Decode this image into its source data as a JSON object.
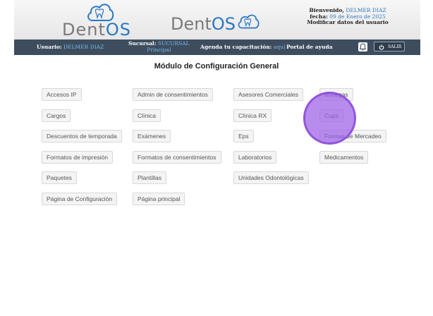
{
  "header": {
    "logo_text": {
      "dent": "Dent",
      "os": "OS"
    },
    "welcome": {
      "greeting": "Bienvenido,",
      "user": "DELMER DIAZ",
      "date_label": "fecha:",
      "date": "09 de Enero de 2025",
      "modify_link": "Modificar datos del usuario"
    }
  },
  "navbar": {
    "usuario_label": "Usuario:",
    "usuario_value": "DELMER DIAZ",
    "sucursal_label": "Sucursal:",
    "sucursal_value_1": "SUCURSAL",
    "sucursal_value_2": "Principal",
    "agenda_label": "Agenda tu capacitación:",
    "agenda_link": "aquí",
    "portal": "Portal de ayuda",
    "salir": "SALIR"
  },
  "page_title": "Módulo de Configuración General",
  "buttons": [
    {
      "label": "Accesos IP"
    },
    {
      "label": "Admin de consentimientos"
    },
    {
      "label": "Asesores Comerciales"
    },
    {
      "label": "Bodegas"
    },
    {
      "label": "Cargos"
    },
    {
      "label": "Clínica"
    },
    {
      "label": "Clínica RX"
    },
    {
      "label": "Cups"
    },
    {
      "label": "Descuentos de temporada"
    },
    {
      "label": "Exámenes"
    },
    {
      "label": "Eps"
    },
    {
      "label": "Formas de Mercadeo"
    },
    {
      "label": "Formatos de impresión"
    },
    {
      "label": "Formatos de consentimientos"
    },
    {
      "label": "Laboratorios"
    },
    {
      "label": "Medicamentos"
    },
    {
      "label": "Paquetes"
    },
    {
      "label": "Plantillas"
    },
    {
      "label": "Unidades Odontológicas"
    },
    {
      "label": "Página de Configuración"
    },
    {
      "label": "Página principal"
    }
  ],
  "colors": {
    "brand_blue": "#2a78c4",
    "navbar_bg": "#3d4d5e",
    "highlight": "#9b5fe6"
  }
}
